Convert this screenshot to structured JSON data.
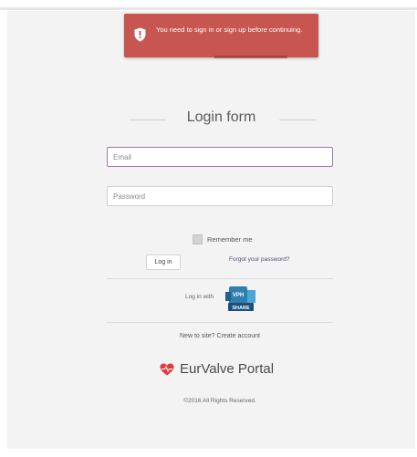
{
  "alert": {
    "text": "You need to sign in or sign up before continuing.",
    "icon": "shield-icon",
    "color": "#c75550"
  },
  "form": {
    "title": "Login form",
    "email_placeholder": "Email",
    "password_placeholder": "Password",
    "remember_label": "Remember me",
    "login_label": "Log in",
    "forgot_label": "Forgot your password?",
    "login_with_label": "Log in with",
    "sso_logo_text": "VPH",
    "sso_logo_subtext": "SHARE"
  },
  "footer": {
    "new_site_text": "New to site? Create account",
    "portal_name": "EurValve Portal",
    "copyright": "©2016 All Rights Reserved.",
    "brand_color": "#e0393e"
  }
}
